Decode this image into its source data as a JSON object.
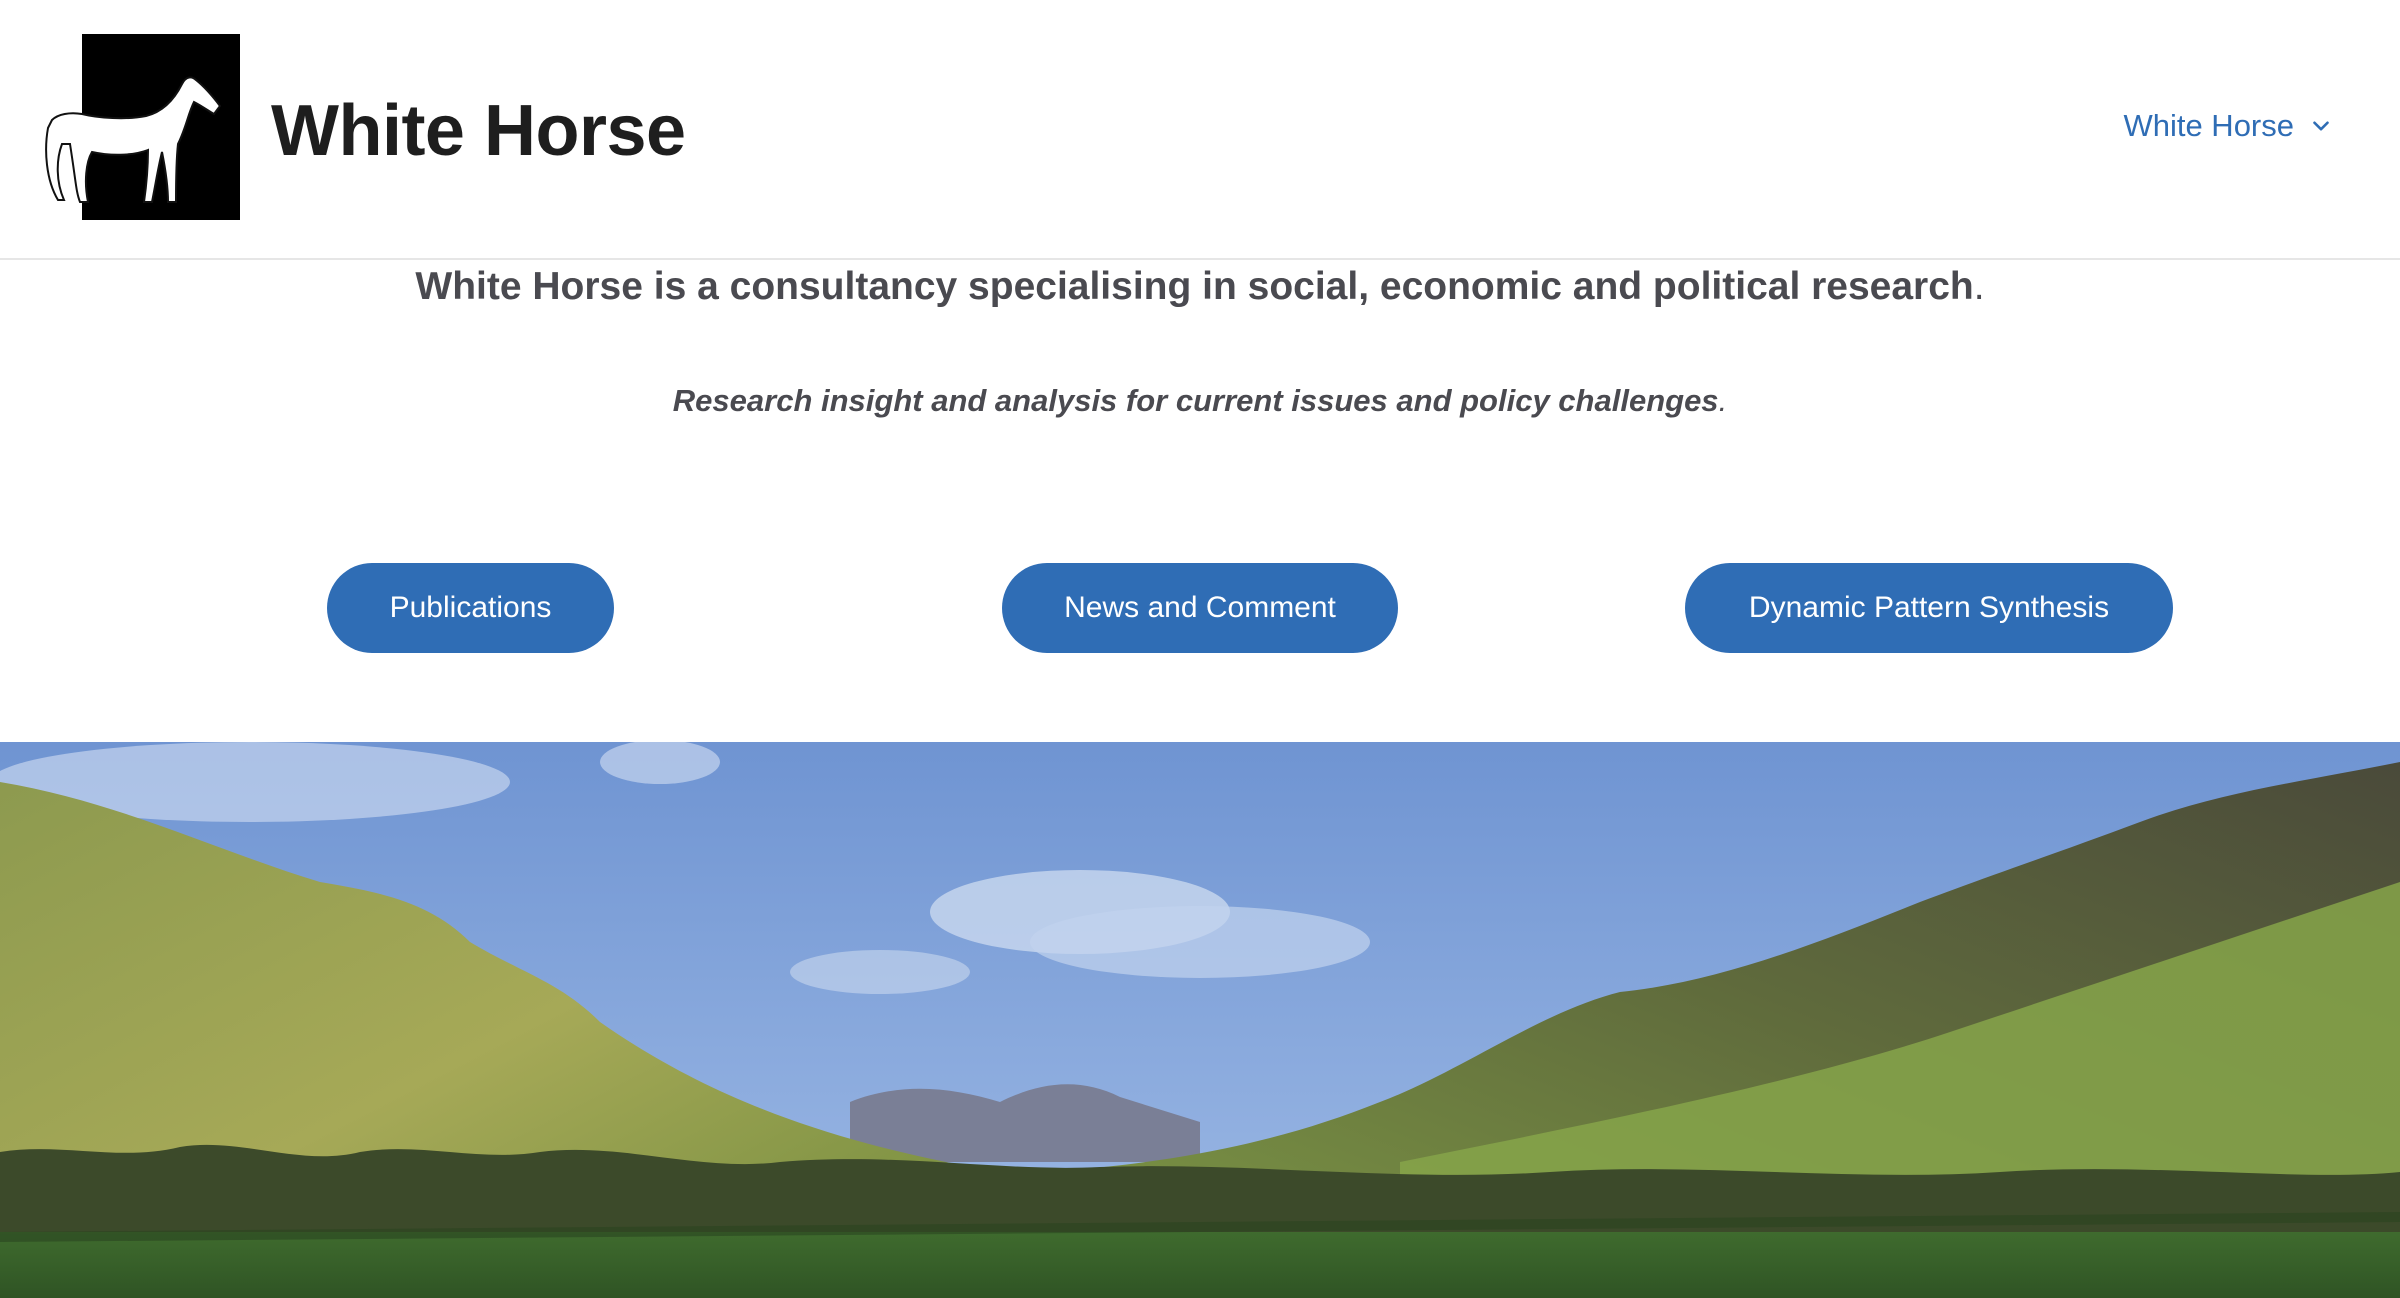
{
  "header": {
    "site_title": "White Horse",
    "logo_icon": "white-horse-logo-icon",
    "nav": {
      "label": "White Horse",
      "icon": "chevron-down-icon"
    }
  },
  "main": {
    "intro": "White Horse is a consultancy specialising in social, economic and political research",
    "intro_punct": ".",
    "tagline": "Research insight and analysis for current issues and policy challenges",
    "tagline_punct": ".",
    "buttons": [
      {
        "label": "Publications"
      },
      {
        "label": "News and Comment"
      },
      {
        "label": "Dynamic Pattern Synthesis"
      }
    ]
  },
  "hero": {
    "description_icon": "mountain-valley-landscape-image"
  },
  "colors": {
    "accent": "#2f6db5",
    "title_text": "#1e1e1e",
    "body_text": "#4a4a50",
    "background": "#ffffff"
  }
}
